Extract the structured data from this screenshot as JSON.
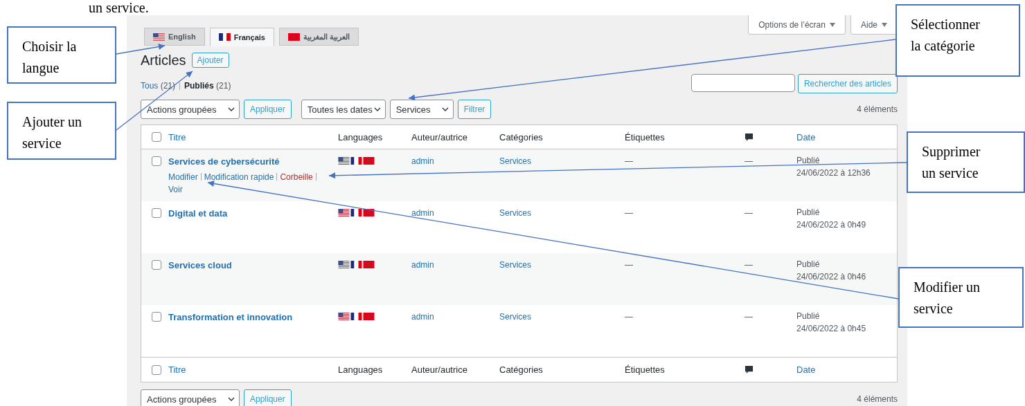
{
  "document_text": "un service.",
  "language_tabs": [
    {
      "label": "English",
      "selected": false
    },
    {
      "label": "Français",
      "selected": true
    },
    {
      "label": "العربية المغربية",
      "selected": false
    }
  ],
  "screen_buttons": [
    "Options de l’écran",
    "Aide"
  ],
  "page_title": "Articles",
  "add_button": "Ajouter",
  "views": [
    {
      "label": "Tous",
      "count": "(21)",
      "selected": false
    },
    {
      "label": "Publiés",
      "count": "(21)",
      "selected": true
    }
  ],
  "search": {
    "button": "Rechercher des articles"
  },
  "filters": {
    "bulk_action": "Actions groupées",
    "apply": "Appliquer",
    "dates": "Toutes les dates",
    "category": "Services",
    "filter": "Filtrer",
    "count": "4 éléments"
  },
  "table": {
    "select_all_checked": false,
    "columns": [
      {
        "label": "Titre",
        "kind": "sortable"
      },
      {
        "label": "Languages",
        "kind": "text"
      },
      {
        "label": "Auteur/autrice",
        "kind": "text"
      },
      {
        "label": "Catégories",
        "kind": "text"
      },
      {
        "label": "Étiquettes",
        "kind": "text"
      },
      {
        "kind": "comments"
      },
      {
        "label": "Date",
        "kind": "sortable"
      }
    ],
    "footer_columns": [
      {
        "label": "Titre",
        "kind": "sortable"
      },
      {
        "label": "Languages",
        "kind": "text"
      },
      {
        "label": "Auteur/autrice",
        "kind": "text"
      },
      {
        "label": "Catégories",
        "kind": "text"
      },
      {
        "label": "Étiquettes",
        "kind": "text"
      },
      {
        "kind": "comments"
      },
      {
        "label": "Date",
        "kind": "sortable"
      }
    ],
    "rows": [
      {
        "checked": false,
        "title": "Services de cybersécurité",
        "actions": [
          {
            "label": "Modifier",
            "kind": "link"
          },
          {
            "label": "Modification rapide",
            "kind": "link"
          },
          {
            "label": "Corbeille",
            "kind": "delete"
          },
          {
            "label": "Voir",
            "kind": "link"
          }
        ],
        "author": "admin",
        "category": "Services",
        "tags": "—",
        "comments": "—",
        "status": "Publié",
        "date": "24/06/2022 à 12h36"
      },
      {
        "checked": false,
        "title": "Digital et data",
        "author": "admin",
        "category": "Services",
        "tags": "—",
        "comments": "—",
        "status": "Publié",
        "date": "24/06/2022 à 0h49"
      },
      {
        "checked": false,
        "title": "Services cloud",
        "author": "admin",
        "category": "Services",
        "tags": "—",
        "comments": "—",
        "status": "Publié",
        "date": "24/06/2022 à 0h46"
      },
      {
        "checked": false,
        "title": "Transformation et innovation",
        "author": "admin",
        "category": "Services",
        "tags": "—",
        "comments": "—",
        "status": "Publié",
        "date": "24/06/2022 à 0h45"
      }
    ]
  },
  "bottom": {
    "bulk_action": "Actions groupées",
    "apply": "Appliquer",
    "count": "4 éléments"
  },
  "annotations": [
    {
      "text": "Choisir la langue"
    },
    {
      "text": "Ajouter un service"
    },
    {
      "text": "Sélectionner la catégorie"
    },
    {
      "text": "Supprimer un service"
    },
    {
      "text": "Modifier un service"
    }
  ]
}
